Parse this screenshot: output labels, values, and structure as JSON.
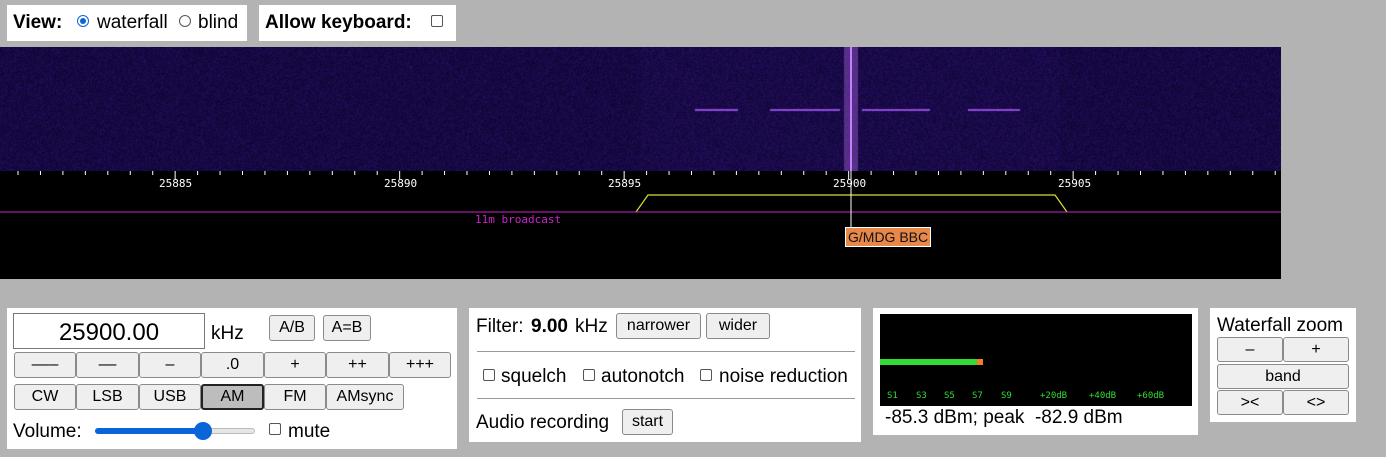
{
  "view": {
    "label": "View:",
    "options": [
      "waterfall",
      "blind"
    ],
    "selected": "waterfall"
  },
  "keyboard": {
    "label": "Allow keyboard:",
    "checked": false
  },
  "scale": {
    "ticks": [
      "25885",
      "25890",
      "25895",
      "25900",
      "25905"
    ]
  },
  "band": {
    "name": "11m broadcast",
    "color": "#cc22cc"
  },
  "station": {
    "label": "G/MDG BBC",
    "color": "#e8874a"
  },
  "tuning": {
    "frequency": "25900.00",
    "unit": "kHz",
    "ab": "A/B",
    "aeqb": "A=B",
    "steps": [
      "–––",
      "––",
      "–",
      ".0",
      "+",
      "++",
      "+++"
    ],
    "modes": [
      "CW",
      "LSB",
      "USB",
      "AM",
      "FM",
      "AMsync"
    ],
    "active_mode": "AM",
    "volume_label": "Volume:",
    "volume_percent": 70,
    "mute_label": "mute",
    "mute_checked": false
  },
  "filter": {
    "label": "Filter:",
    "value": "9.00",
    "unit": "kHz",
    "narrower": "narrower",
    "wider": "wider",
    "squelch": "squelch",
    "autonotch": "autonotch",
    "noise_reduction": "noise reduction",
    "recording_label": "Audio recording",
    "start": "start"
  },
  "smeter": {
    "scale": [
      "S1",
      "S3",
      "S5",
      "S7",
      "S9",
      "+20dB",
      "+40dB",
      "+60dB"
    ],
    "level_fraction": 0.33,
    "readout": "-85.3 dBm; peak  -82.9 dBm",
    "bar_color": "#33dd33",
    "peak_color": "#f08020"
  },
  "zoom": {
    "title": "Waterfall zoom",
    "minus": "–",
    "plus": "+",
    "band": "band",
    "narrow": "><",
    "wide": "<>"
  }
}
